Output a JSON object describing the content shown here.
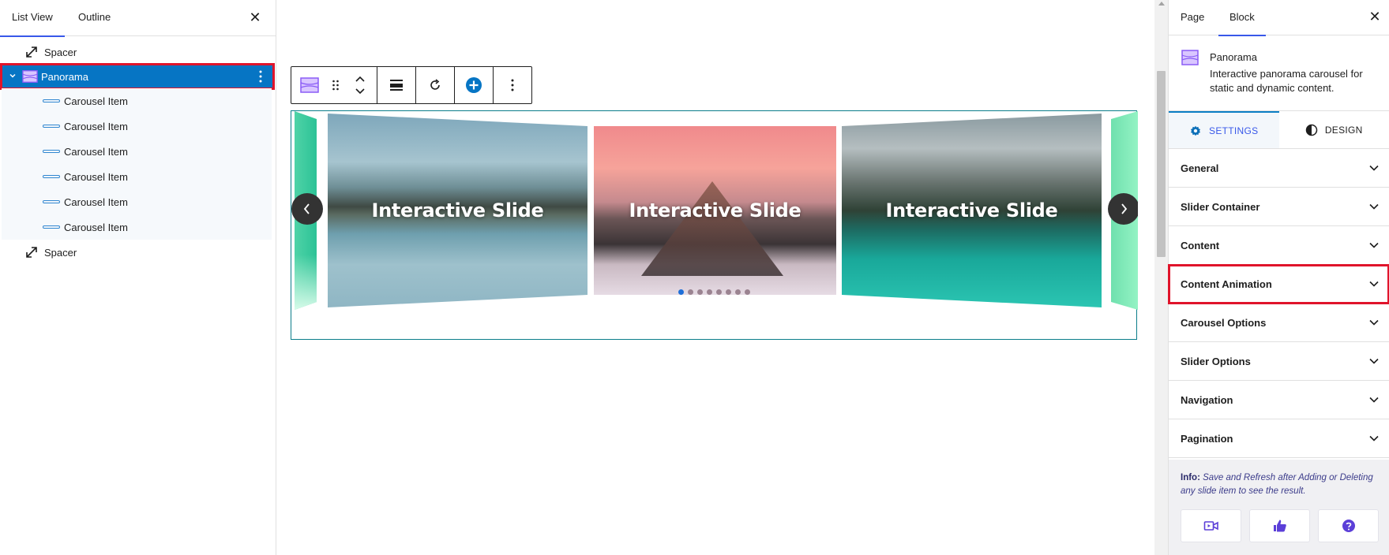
{
  "list_view": {
    "tabs": [
      {
        "label": "List View"
      },
      {
        "label": "Outline"
      }
    ],
    "close_icon": "close-icon",
    "items": [
      {
        "label": "Spacer",
        "icon": "resize-arrow-icon"
      },
      {
        "label": "Panorama",
        "icon": "panorama-block-icon",
        "selected": true
      },
      {
        "label": "Carousel Item"
      },
      {
        "label": "Carousel Item"
      },
      {
        "label": "Carousel Item"
      },
      {
        "label": "Carousel Item"
      },
      {
        "label": "Carousel Item"
      },
      {
        "label": "Carousel Item"
      },
      {
        "label": "Spacer",
        "icon": "resize-arrow-icon"
      }
    ]
  },
  "canvas": {
    "slides": [
      {
        "label": "Interactive Slide"
      },
      {
        "label": "Interactive Slide"
      },
      {
        "label": "Interactive Slide"
      }
    ],
    "pagination": {
      "count": 8,
      "active_index": 0
    }
  },
  "sidebar": {
    "tabs": [
      {
        "label": "Page"
      },
      {
        "label": "Block"
      }
    ],
    "block": {
      "title": "Panorama",
      "description": "Interactive panorama carousel for static and dynamic content."
    },
    "setting_tabs": [
      {
        "label": "SETTINGS"
      },
      {
        "label": "DESIGN"
      }
    ],
    "panels": [
      {
        "label": "General"
      },
      {
        "label": "Slider Container"
      },
      {
        "label": "Content"
      },
      {
        "label": "Content Animation",
        "highlighted": true
      },
      {
        "label": "Carousel Options"
      },
      {
        "label": "Slider Options"
      },
      {
        "label": "Navigation"
      },
      {
        "label": "Pagination"
      }
    ],
    "info": {
      "prefix": "Info:",
      "text": "Save and Refresh after Adding or Deleting any slide item to see the result."
    }
  },
  "colors": {
    "selected_row": "#0675c4",
    "highlight": "#e0142b",
    "accent": "#3858e9",
    "block_border": "#0b7d8a"
  }
}
